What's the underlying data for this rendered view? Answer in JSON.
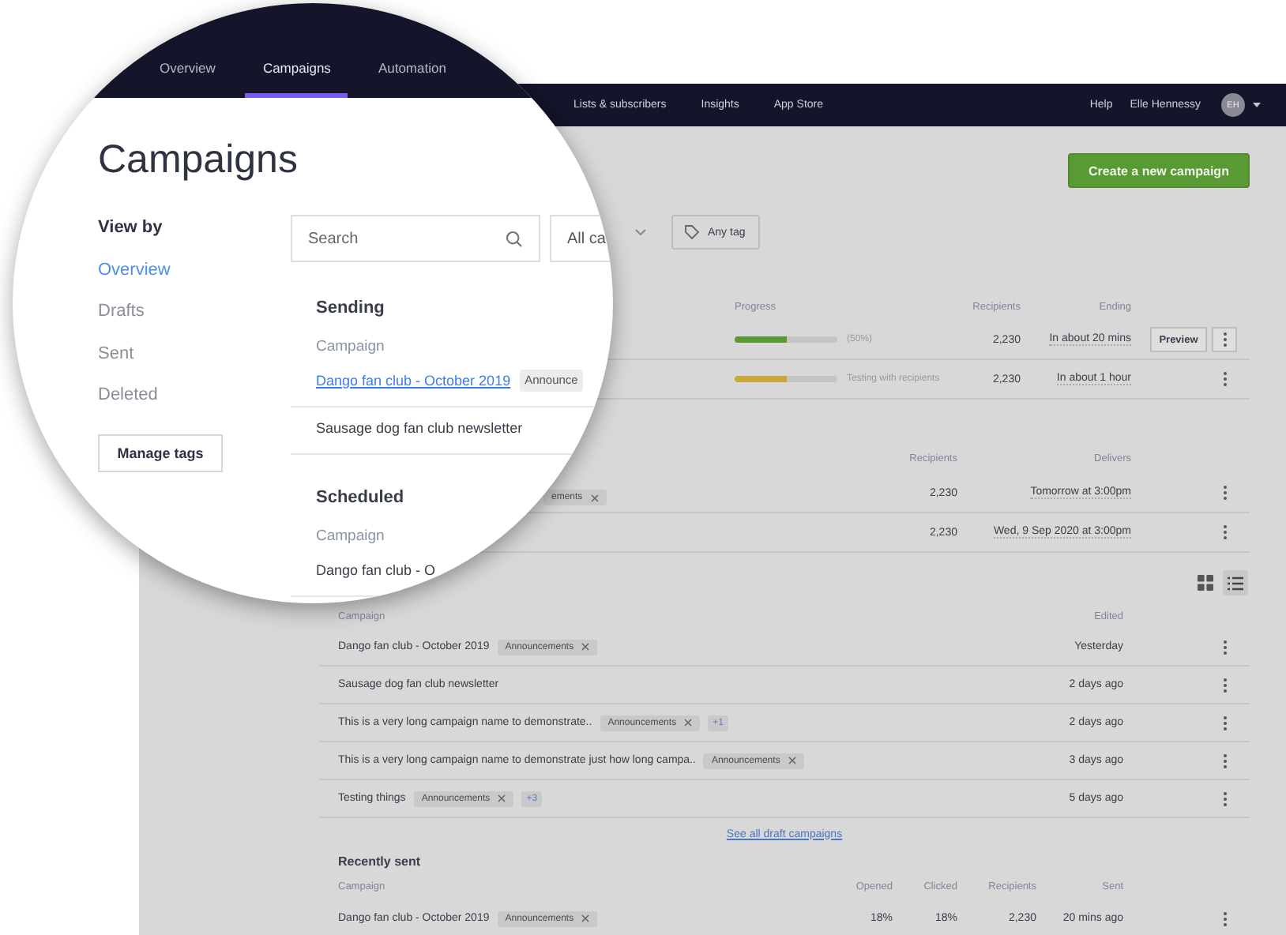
{
  "lens": {
    "nav": [
      {
        "label": "Overview",
        "selected": false
      },
      {
        "label": "Campaigns",
        "selected": true
      },
      {
        "label": "Automation",
        "selected": false
      }
    ],
    "title": "Campaigns",
    "view_by": {
      "heading": "View by",
      "items": [
        {
          "label": "Overview",
          "selected": true
        },
        {
          "label": "Drafts",
          "selected": false
        },
        {
          "label": "Sent",
          "selected": false
        },
        {
          "label": "Deleted",
          "selected": false
        }
      ]
    },
    "manage_tags": "Manage tags",
    "search": {
      "placeholder": "Search"
    },
    "status_filter": {
      "value": "All ca"
    },
    "sections": [
      {
        "title": "Sending",
        "column": "Campaign",
        "rows": [
          {
            "name": "Dango fan club - October 2019",
            "link": true,
            "tag": "Announce"
          },
          {
            "name": "Sausage dog fan club newsletter",
            "link": false
          }
        ]
      },
      {
        "title": "Scheduled",
        "column": "Campaign",
        "rows": [
          {
            "name": "Dango fan club - O",
            "link": false
          }
        ]
      }
    ]
  },
  "page": {
    "nav": [
      "Lists & subscribers",
      "Insights",
      "App Store"
    ],
    "help": "Help",
    "user": "Elle Hennessy",
    "avatar": "EH",
    "create_button": "Create a new campaign",
    "tag_filter": "Any tag",
    "sending": {
      "columns": {
        "progress": "Progress",
        "recipients": "Recipients",
        "ending": "Ending"
      },
      "rows": [
        {
          "kind": "sending",
          "level": 0.5,
          "status": "(50%)",
          "recipients": "2,230",
          "ending": "In about 20 mins",
          "preview": "Preview"
        },
        {
          "kind": "testing",
          "level": 0.5,
          "status": "Testing with recipients",
          "recipients": "2,230",
          "ending": "In about 1 hour"
        }
      ]
    },
    "scheduled": {
      "columns": {
        "recipients": "Recipients",
        "delivers": "Delivers"
      },
      "rows": [
        {
          "tag": "ements",
          "recipients": "2,230",
          "delivers": "Tomorrow at 3:00pm"
        },
        {
          "recipients": "2,230",
          "delivers": "Wed, 9 Sep 2020 at 3:00pm"
        }
      ]
    },
    "view_toggle": [
      {
        "kind": "grid",
        "selected": false
      },
      {
        "kind": "list",
        "selected": true
      }
    ],
    "drafts": {
      "columns": {
        "campaign": "Campaign",
        "edited": "Edited"
      },
      "rows": [
        {
          "name": "Dango fan club - October 2019",
          "tags": [
            "Announcements"
          ],
          "edited": "Yesterday"
        },
        {
          "name": "Sausage dog fan club newsletter",
          "tags": [],
          "edited": "2 days ago"
        },
        {
          "name": "This is a very long campaign name to demonstrate..",
          "tags": [
            "Announcements"
          ],
          "more": "+1",
          "edited": "2 days ago"
        },
        {
          "name": "This is a very long campaign name to demonstrate just how long campa..",
          "tags": [
            "Announcements"
          ],
          "edited": "3 days ago"
        },
        {
          "name": "Testing things",
          "tags": [
            "Announcements"
          ],
          "more": "+3",
          "edited": "5 days ago"
        }
      ],
      "see_all": "See all draft campaigns"
    },
    "recently_sent": {
      "title": "Recently sent",
      "columns": {
        "campaign": "Campaign",
        "opened": "Opened",
        "clicked": "Clicked",
        "recipients": "Recipients",
        "sent": "Sent"
      },
      "rows": [
        {
          "name": "Dango fan club - October 2019",
          "tags": [
            "Announcements"
          ],
          "opened": "18%",
          "clicked": "18%",
          "recipients": "2,230",
          "sent": "20 mins ago"
        }
      ]
    }
  }
}
